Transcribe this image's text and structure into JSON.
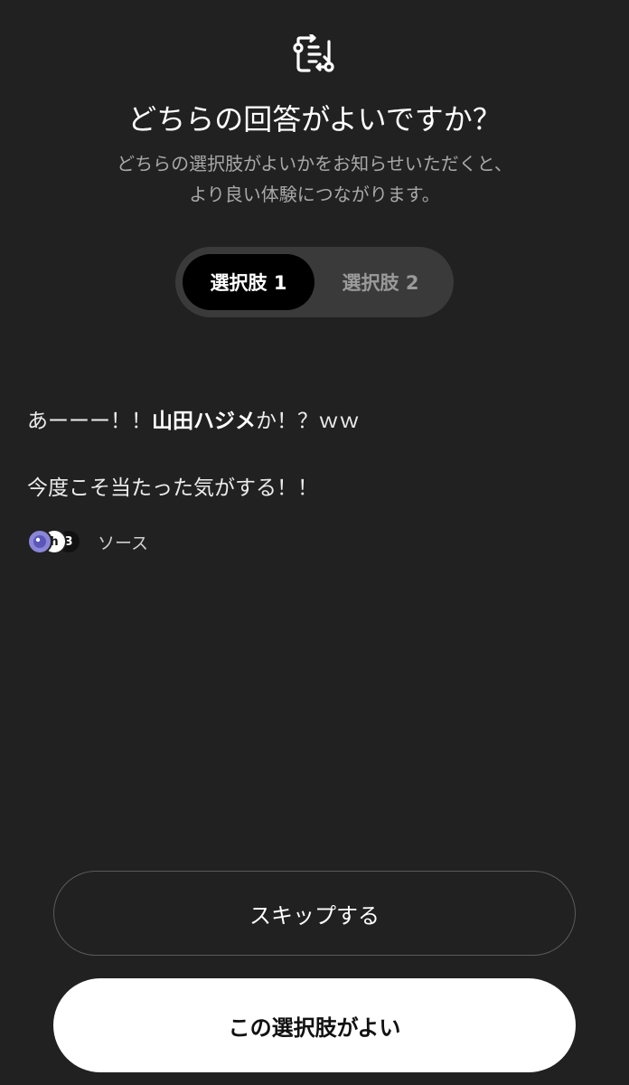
{
  "header": {
    "icon": "compare-responses-icon",
    "title": "どちらの回答がよいですか？",
    "subtitle_line1": "どちらの選択肢がよいかをお知らせいただくと、",
    "subtitle_line2": "より良い体験につながります。"
  },
  "segment": {
    "option1_label": "選択肢 1",
    "option2_label": "選択肢 2",
    "selected": "option1"
  },
  "response": {
    "line1_prefix": "あーーー！！",
    "line1_bold": "山田ハジメ",
    "line1_suffix": "か！？ｗｗ",
    "line2": "今度こそ当たった気がする！！",
    "sources_label": "ソース",
    "source_favicons": [
      "ai-avatar-icon",
      "h",
      "3"
    ]
  },
  "actions": {
    "skip_label": "スキップする",
    "prefer_label": "この選択肢がよい"
  },
  "colors": {
    "background": "#212121",
    "segment_bg": "#3a3a3a",
    "selected_segment": "#000000",
    "primary_button": "#ffffff"
  }
}
